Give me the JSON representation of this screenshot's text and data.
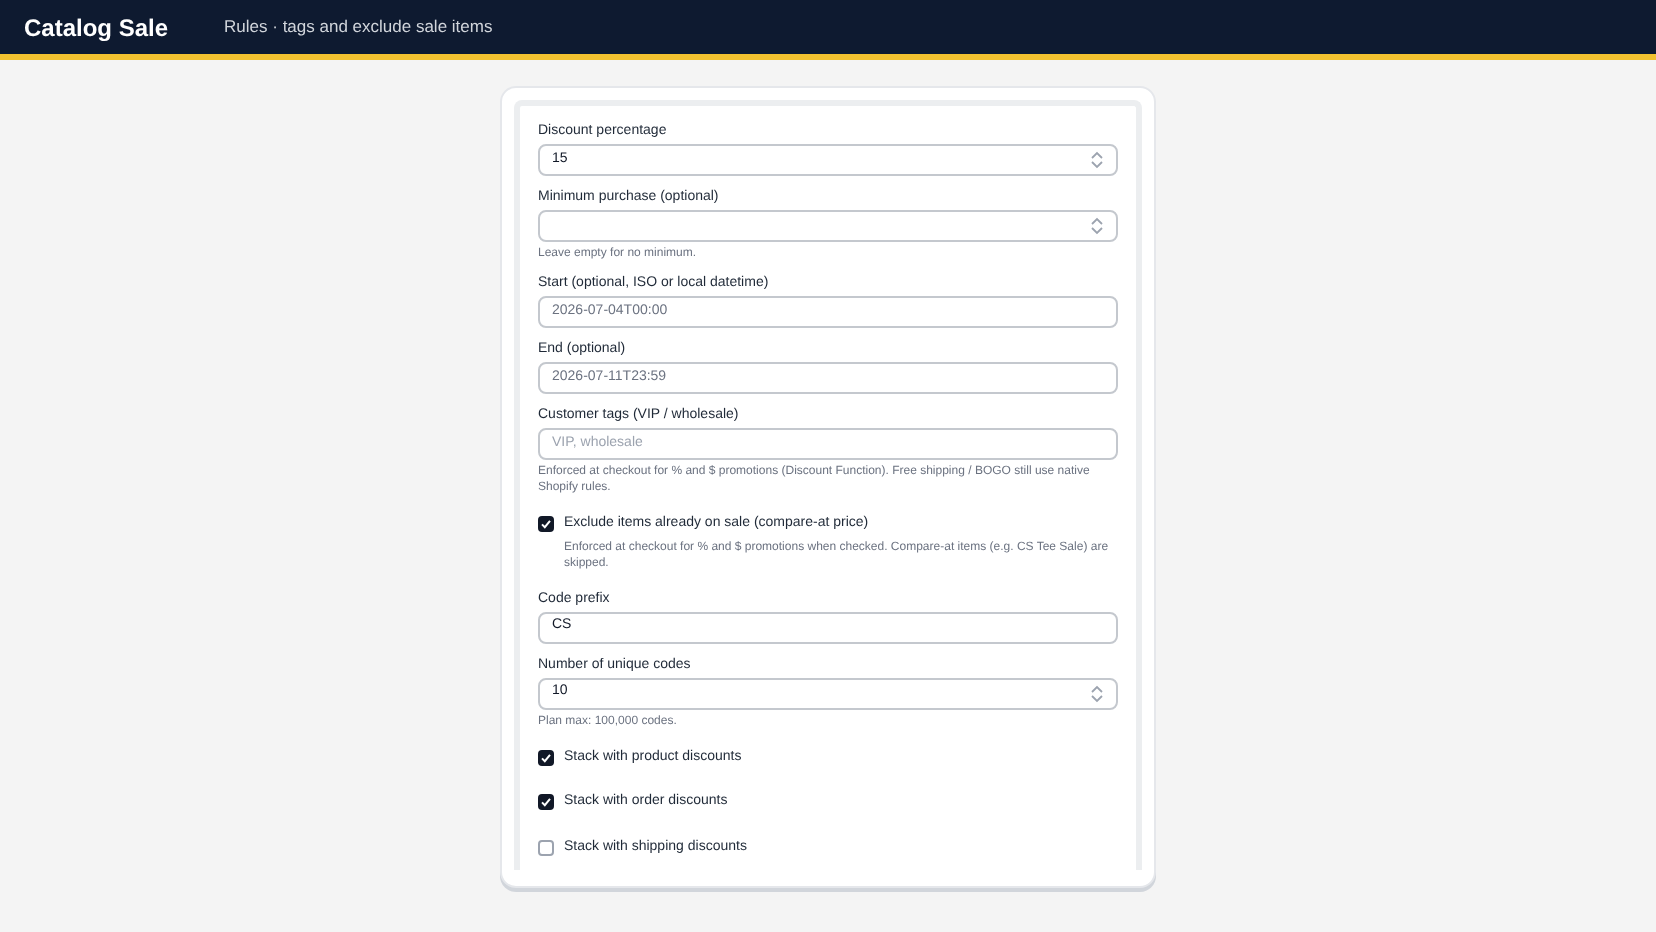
{
  "header": {
    "title": "Catalog Sale",
    "subtitle": "Rules · tags and exclude sale items"
  },
  "fields": [
    {
      "kind": "number",
      "label": "Discount percentage",
      "value": "15"
    },
    {
      "kind": "number",
      "label": "Minimum purchase (optional)",
      "hint": "Leave empty for no minimum."
    },
    {
      "kind": "text",
      "label": "Start (optional, ISO or local datetime)",
      "value": "2026-07-04T00:00"
    },
    {
      "kind": "text",
      "label": "End (optional)",
      "value": "2026-07-11T23:59"
    },
    {
      "kind": "text",
      "label": "Customer tags (VIP / wholesale)",
      "placeholder": "VIP, wholesale",
      "hint": "Enforced at checkout for % and $ promotions (Discount Function). Free shipping / BOGO still use native Shopify rules."
    },
    {
      "kind": "checkbox",
      "label": "Exclude items already on sale (compare-at price)",
      "checked": true,
      "hint": "Enforced at checkout for % and $ promotions when checked. Compare-at items (e.g. CS Tee Sale) are skipped."
    },
    {
      "kind": "text",
      "label": "Code prefix",
      "value": "CS"
    },
    {
      "kind": "number",
      "label": "Number of unique codes",
      "value": "10",
      "hint": "Plan max: 100,000 codes."
    },
    {
      "kind": "checkbox",
      "label": "Stack with product discounts",
      "checked": true
    },
    {
      "kind": "checkbox",
      "label": "Stack with order discounts",
      "checked": true
    },
    {
      "kind": "checkbox",
      "label": "Stack with shipping discounts",
      "checked": false
    }
  ]
}
